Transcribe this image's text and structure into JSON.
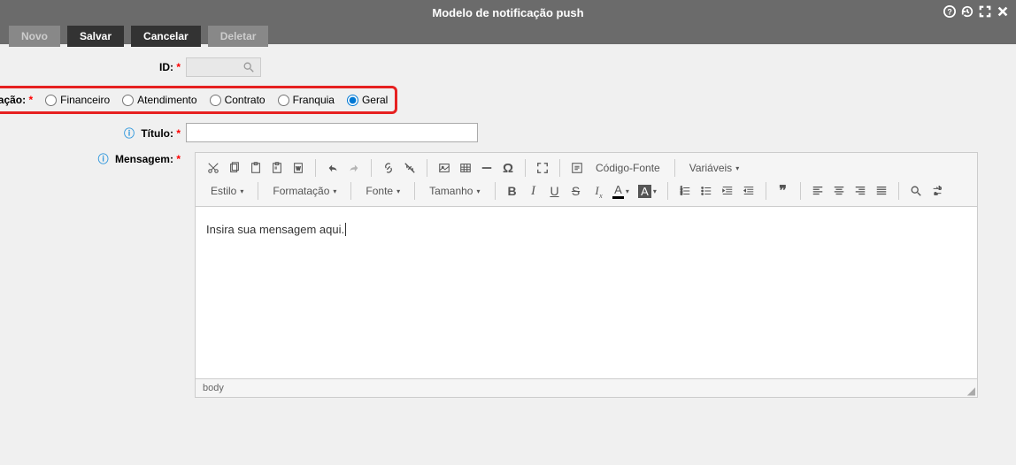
{
  "header": {
    "title": "Modelo de notificação push"
  },
  "toolbar": {
    "novo": "Novo",
    "salvar": "Salvar",
    "cancelar": "Cancelar",
    "deletar": "Deletar"
  },
  "form": {
    "id_label": "ID:",
    "tipo_label": "Tipo de notificação:",
    "titulo_label": "Título:",
    "mensagem_label": "Mensagem:",
    "radios": {
      "financeiro": "Financeiro",
      "atendimento": "Atendimento",
      "contrato": "Contrato",
      "franquia": "Franquia",
      "geral": "Geral"
    },
    "selected_radio": "geral"
  },
  "editor": {
    "estilo": "Estilo",
    "formatacao": "Formatação",
    "fonte": "Fonte",
    "tamanho": "Tamanho",
    "codigo_fonte": "Código-Fonte",
    "variaveis": "Variáveis",
    "placeholder": "Insira sua mensagem aqui.",
    "footer": "body"
  }
}
